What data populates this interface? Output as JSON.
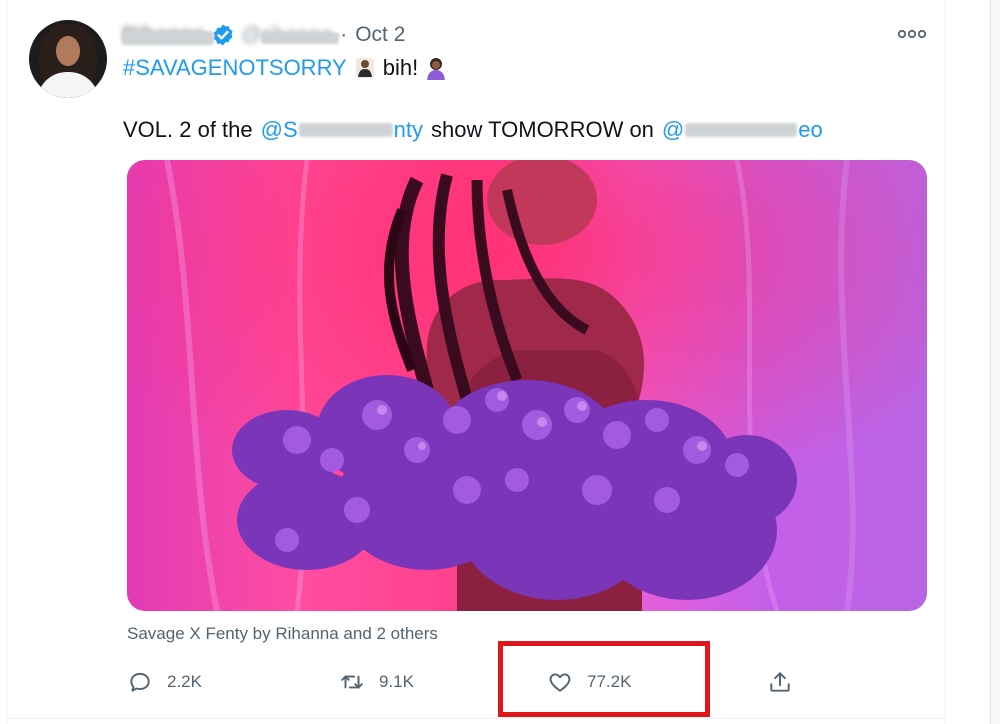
{
  "tweet": {
    "author": {
      "display_name": "Rihanna",
      "handle": "@rihanna",
      "verified": true
    },
    "separator": "·",
    "date": "Oct 2",
    "text_line1": {
      "hashtag": "#SAVAGENOTSORRY",
      "suffix": "bih!"
    },
    "text_line2": {
      "prefix": "VOL. 2 of the",
      "mention1_visible_start": "@S",
      "mention1_visible_end": "nty",
      "middle": "show TOMORROW on",
      "mention2_visible_start": "@",
      "mention2_visible_end": "eo"
    },
    "attribution": "Savage X Fenty by Rihanna and 2 others",
    "actions": {
      "reply_count": "2.2K",
      "retweet_count": "9.1K",
      "like_count": "77.2K"
    }
  },
  "colors": {
    "link": "#1d9bf0",
    "secondary_text": "#536471",
    "highlight": "#e0161c"
  },
  "icons": [
    "verified-badge-icon",
    "more-options-icon",
    "reply-icon",
    "retweet-icon",
    "like-heart-icon",
    "share-icon"
  ]
}
